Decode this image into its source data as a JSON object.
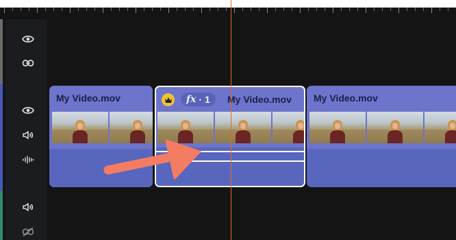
{
  "colors": {
    "track_bg": "#141414",
    "header_bg": "#1b1c1f",
    "clip_fill": "#6d74cc",
    "clip_audio": "#5866bd",
    "selected_border": "#ffffff",
    "playhead": "#e2692a",
    "annotation_arrow": "#f47c62",
    "video_strip": "#4a58b5",
    "audio_strip": "#2f8a6e",
    "title_strip": "#6b6b6b"
  },
  "tracks": [
    {
      "kind": "title",
      "icons": [
        "eye-icon",
        "link-icon"
      ]
    },
    {
      "kind": "video",
      "icons": [
        "eye-icon",
        "speaker-icon",
        "waveform-icon"
      ]
    },
    {
      "kind": "audio",
      "icons": [
        "speaker-icon",
        "unlink-icon"
      ]
    }
  ],
  "clips": [
    {
      "name": "My Video.mov",
      "selected": false
    },
    {
      "name": "My Video.mov",
      "selected": true,
      "effects_badge": {
        "icon": "crown-icon",
        "fx_label": "fx",
        "separator": "·",
        "count": "1"
      }
    },
    {
      "name": "My Video.mov",
      "selected": false
    }
  ],
  "annotation": {
    "type": "arrow",
    "icon": "arrow-icon"
  }
}
